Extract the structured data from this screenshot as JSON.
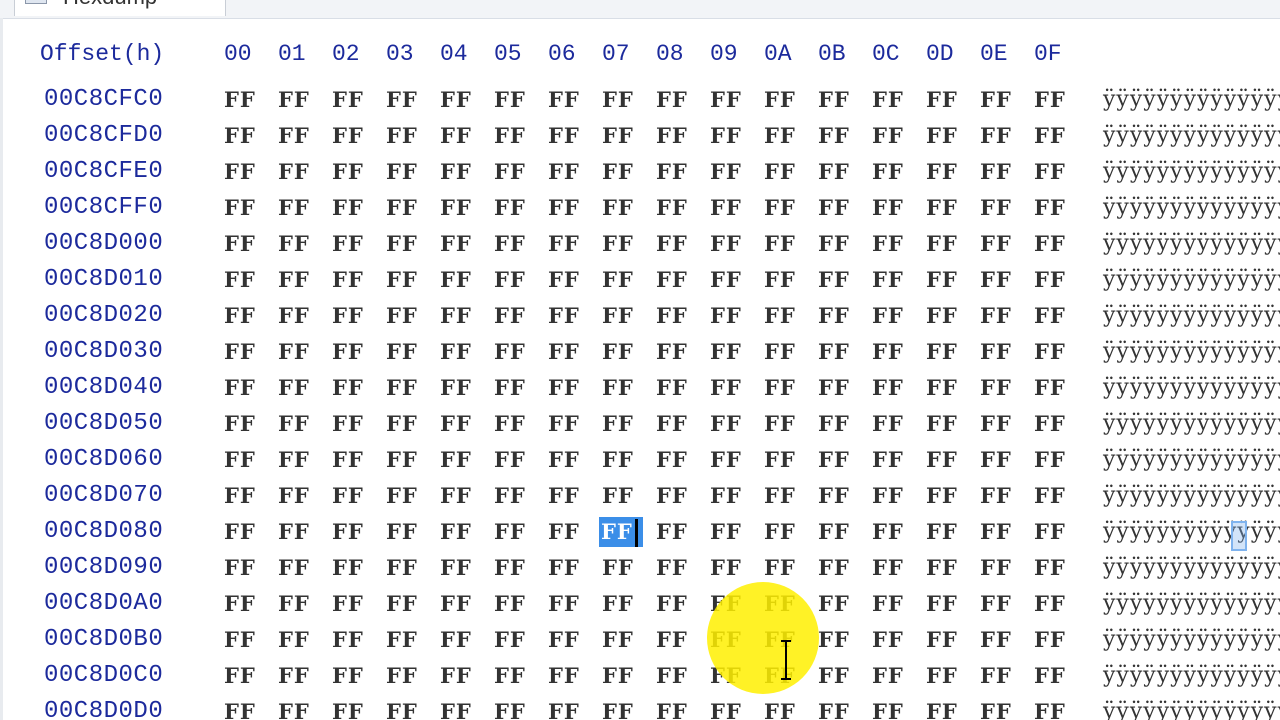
{
  "tab": {
    "label": "Hexdump",
    "icon": "file-icon"
  },
  "header": {
    "offset_label": "Offset(h)",
    "columns": [
      "00",
      "01",
      "02",
      "03",
      "04",
      "05",
      "06",
      "07",
      "08",
      "09",
      "0A",
      "0B",
      "0C",
      "0D",
      "0E",
      "0F"
    ]
  },
  "rows": [
    {
      "offset": "00C8CFC0",
      "bytes": [
        "FF",
        "FF",
        "FF",
        "FF",
        "FF",
        "FF",
        "FF",
        "FF",
        "FF",
        "FF",
        "FF",
        "FF",
        "FF",
        "FF",
        "FF",
        "FF"
      ],
      "ascii": "ÿÿÿÿÿÿÿÿÿÿÿÿÿÿÿÿ"
    },
    {
      "offset": "00C8CFD0",
      "bytes": [
        "FF",
        "FF",
        "FF",
        "FF",
        "FF",
        "FF",
        "FF",
        "FF",
        "FF",
        "FF",
        "FF",
        "FF",
        "FF",
        "FF",
        "FF",
        "FF"
      ],
      "ascii": "ÿÿÿÿÿÿÿÿÿÿÿÿÿÿÿÿ"
    },
    {
      "offset": "00C8CFE0",
      "bytes": [
        "FF",
        "FF",
        "FF",
        "FF",
        "FF",
        "FF",
        "FF",
        "FF",
        "FF",
        "FF",
        "FF",
        "FF",
        "FF",
        "FF",
        "FF",
        "FF"
      ],
      "ascii": "ÿÿÿÿÿÿÿÿÿÿÿÿÿÿÿÿ"
    },
    {
      "offset": "00C8CFF0",
      "bytes": [
        "FF",
        "FF",
        "FF",
        "FF",
        "FF",
        "FF",
        "FF",
        "FF",
        "FF",
        "FF",
        "FF",
        "FF",
        "FF",
        "FF",
        "FF",
        "FF"
      ],
      "ascii": "ÿÿÿÿÿÿÿÿÿÿÿÿÿÿÿÿ"
    },
    {
      "offset": "00C8D000",
      "bytes": [
        "FF",
        "FF",
        "FF",
        "FF",
        "FF",
        "FF",
        "FF",
        "FF",
        "FF",
        "FF",
        "FF",
        "FF",
        "FF",
        "FF",
        "FF",
        "FF"
      ],
      "ascii": "ÿÿÿÿÿÿÿÿÿÿÿÿÿÿÿÿ"
    },
    {
      "offset": "00C8D010",
      "bytes": [
        "FF",
        "FF",
        "FF",
        "FF",
        "FF",
        "FF",
        "FF",
        "FF",
        "FF",
        "FF",
        "FF",
        "FF",
        "FF",
        "FF",
        "FF",
        "FF"
      ],
      "ascii": "ÿÿÿÿÿÿÿÿÿÿÿÿÿÿÿÿ"
    },
    {
      "offset": "00C8D020",
      "bytes": [
        "FF",
        "FF",
        "FF",
        "FF",
        "FF",
        "FF",
        "FF",
        "FF",
        "FF",
        "FF",
        "FF",
        "FF",
        "FF",
        "FF",
        "FF",
        "FF"
      ],
      "ascii": "ÿÿÿÿÿÿÿÿÿÿÿÿÿÿÿÿ"
    },
    {
      "offset": "00C8D030",
      "bytes": [
        "FF",
        "FF",
        "FF",
        "FF",
        "FF",
        "FF",
        "FF",
        "FF",
        "FF",
        "FF",
        "FF",
        "FF",
        "FF",
        "FF",
        "FF",
        "FF"
      ],
      "ascii": "ÿÿÿÿÿÿÿÿÿÿÿÿÿÿÿÿ"
    },
    {
      "offset": "00C8D040",
      "bytes": [
        "FF",
        "FF",
        "FF",
        "FF",
        "FF",
        "FF",
        "FF",
        "FF",
        "FF",
        "FF",
        "FF",
        "FF",
        "FF",
        "FF",
        "FF",
        "FF"
      ],
      "ascii": "ÿÿÿÿÿÿÿÿÿÿÿÿÿÿÿÿ"
    },
    {
      "offset": "00C8D050",
      "bytes": [
        "FF",
        "FF",
        "FF",
        "FF",
        "FF",
        "FF",
        "FF",
        "FF",
        "FF",
        "FF",
        "FF",
        "FF",
        "FF",
        "FF",
        "FF",
        "FF"
      ],
      "ascii": "ÿÿÿÿÿÿÿÿÿÿÿÿÿÿÿÿ"
    },
    {
      "offset": "00C8D060",
      "bytes": [
        "FF",
        "FF",
        "FF",
        "FF",
        "FF",
        "FF",
        "FF",
        "FF",
        "FF",
        "FF",
        "FF",
        "FF",
        "FF",
        "FF",
        "FF",
        "FF"
      ],
      "ascii": "ÿÿÿÿÿÿÿÿÿÿÿÿÿÿÿÿ"
    },
    {
      "offset": "00C8D070",
      "bytes": [
        "FF",
        "FF",
        "FF",
        "FF",
        "FF",
        "FF",
        "FF",
        "FF",
        "FF",
        "FF",
        "FF",
        "FF",
        "FF",
        "FF",
        "FF",
        "FF"
      ],
      "ascii": "ÿÿÿÿÿÿÿÿÿÿÿÿÿÿÿÿ"
    },
    {
      "offset": "00C8D080",
      "bytes": [
        "FF",
        "FF",
        "FF",
        "FF",
        "FF",
        "FF",
        "FF",
        "FF",
        "FF",
        "FF",
        "FF",
        "FF",
        "FF",
        "FF",
        "FF",
        "FF"
      ],
      "ascii": "ÿÿÿÿÿÿÿÿÿÿÿÿÿÿÿÿ"
    },
    {
      "offset": "00C8D090",
      "bytes": [
        "FF",
        "FF",
        "FF",
        "FF",
        "FF",
        "FF",
        "FF",
        "FF",
        "FF",
        "FF",
        "FF",
        "FF",
        "FF",
        "FF",
        "FF",
        "FF"
      ],
      "ascii": "ÿÿÿÿÿÿÿÿÿÿÿÿÿÿÿÿ"
    },
    {
      "offset": "00C8D0A0",
      "bytes": [
        "FF",
        "FF",
        "FF",
        "FF",
        "FF",
        "FF",
        "FF",
        "FF",
        "FF",
        "FF",
        "FF",
        "FF",
        "FF",
        "FF",
        "FF",
        "FF"
      ],
      "ascii": "ÿÿÿÿÿÿÿÿÿÿÿÿÿÿÿÿ"
    },
    {
      "offset": "00C8D0B0",
      "bytes": [
        "FF",
        "FF",
        "FF",
        "FF",
        "FF",
        "FF",
        "FF",
        "FF",
        "FF",
        "FF",
        "FF",
        "FF",
        "FF",
        "FF",
        "FF",
        "FF"
      ],
      "ascii": "ÿÿÿÿÿÿÿÿÿÿÿÿÿÿÿÿ"
    },
    {
      "offset": "00C8D0C0",
      "bytes": [
        "FF",
        "FF",
        "FF",
        "FF",
        "FF",
        "FF",
        "FF",
        "FF",
        "FF",
        "FF",
        "FF",
        "FF",
        "FF",
        "FF",
        "FF",
        "FF"
      ],
      "ascii": "ÿÿÿÿÿÿÿÿÿÿÿÿÿÿÿÿ"
    },
    {
      "offset": "00C8D0D0",
      "bytes": [
        "FF",
        "FF",
        "FF",
        "FF",
        "FF",
        "FF",
        "FF",
        "FF",
        "FF",
        "FF",
        "FF",
        "FF",
        "FF",
        "FF",
        "FF",
        "FF"
      ],
      "ascii": "ÿÿÿÿÿÿÿÿÿÿÿÿÿÿÿÿ"
    }
  ],
  "selection": {
    "row_offset": "00C8D080",
    "column": "07"
  },
  "colors": {
    "offset_text": "#1c2a9c",
    "byte_text": "#333333",
    "selection": "#3b8ee8",
    "cursor_highlight": "#fff000"
  }
}
